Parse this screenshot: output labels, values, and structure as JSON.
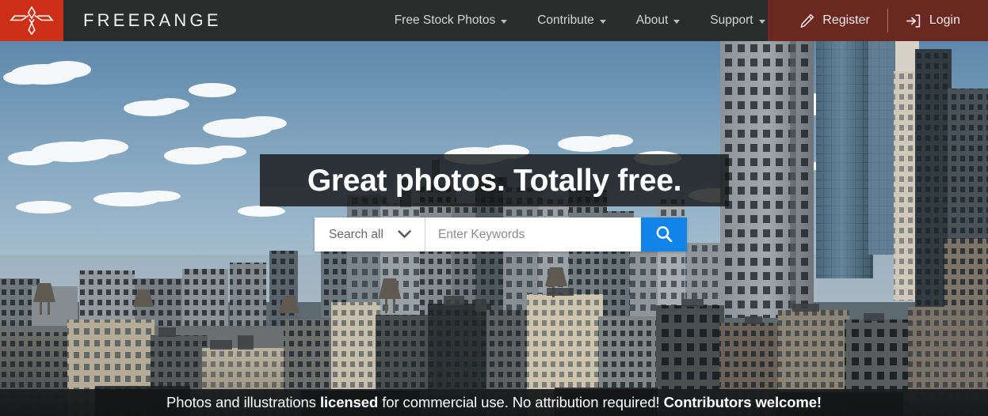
{
  "header": {
    "brand": "FREERANGE",
    "logo_icon": "freerange-bird-logo-icon",
    "logo_bg": "#cc3118",
    "bar_bg": "#2b2d2d",
    "nav": [
      {
        "label": "Free Stock Photos",
        "icon": "chevron-down-icon"
      },
      {
        "label": "Contribute",
        "icon": "chevron-down-icon"
      },
      {
        "label": "About",
        "icon": "chevron-down-icon"
      },
      {
        "label": "Support",
        "icon": "chevron-down-icon"
      }
    ],
    "auth": {
      "bg": "#6b2820",
      "register_label": "Register",
      "register_icon": "pencil-icon",
      "login_label": "Login",
      "login_icon": "sign-in-icon"
    }
  },
  "hero": {
    "headline_part1": "Great photos.",
    "headline_part2": "Totally free.",
    "image_description": "Aerial view of a New York City skyline with skyscrapers, brick rooftops, water towers and a blue sky with scattered white clouds"
  },
  "search": {
    "select_label": "Search all",
    "select_icon": "chevron-down-icon",
    "placeholder": "Enter Keywords",
    "value": "",
    "button_icon": "search-icon",
    "button_color": "#1283e8"
  },
  "banner": {
    "text_1": "Photos and illustrations ",
    "bold_1": "licensed",
    "text_2": " for commercial use. No attribution required! ",
    "bold_2": "Contributors welcome!"
  }
}
